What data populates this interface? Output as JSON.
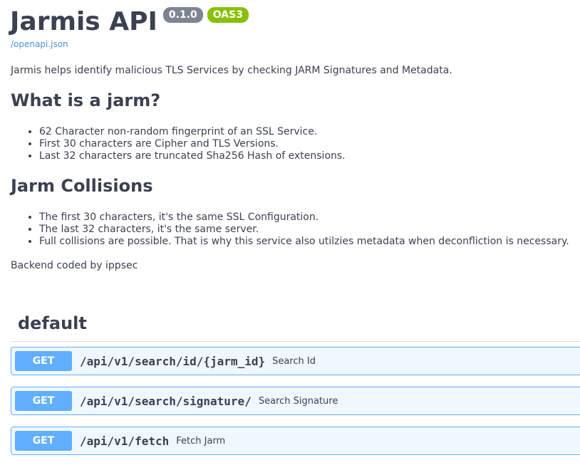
{
  "info": {
    "title": "Jarmis API",
    "version": "0.1.0",
    "oas": "OAS3",
    "spec_url": "/openapi.json",
    "description": "Jarmis helps identify malicious TLS Services by checking JARM Signatures and Metadata."
  },
  "sections": [
    {
      "heading": "What is a jarm?",
      "items": [
        "62 Character non-random fingerprint of an SSL Service.",
        "First 30 characters are Cipher and TLS Versions.",
        "Last 32 characters are truncated Sha256 Hash of extensions."
      ]
    },
    {
      "heading": "Jarm Collisions",
      "items": [
        "The first 30 characters, it's the same SSL Configuration.",
        "The last 32 characters, it's the same server.",
        "Full collisions are possible. That is why this service also utilzies metadata when deconfliction is necessary."
      ]
    }
  ],
  "footer_note": "Backend coded by ippsec",
  "tag": "default",
  "operations": [
    {
      "method": "GET",
      "path": "/api/v1/search/id/{jarm_id}",
      "summary": "Search Id"
    },
    {
      "method": "GET",
      "path": "/api/v1/search/signature/",
      "summary": "Search Signature"
    },
    {
      "method": "GET",
      "path": "/api/v1/fetch",
      "summary": "Fetch Jarm"
    }
  ],
  "colors": {
    "get_method": "#61affe",
    "version_badge": "#7d8492",
    "oas_badge": "#89bf04",
    "link": "#4990e2",
    "text": "#3b4151"
  }
}
